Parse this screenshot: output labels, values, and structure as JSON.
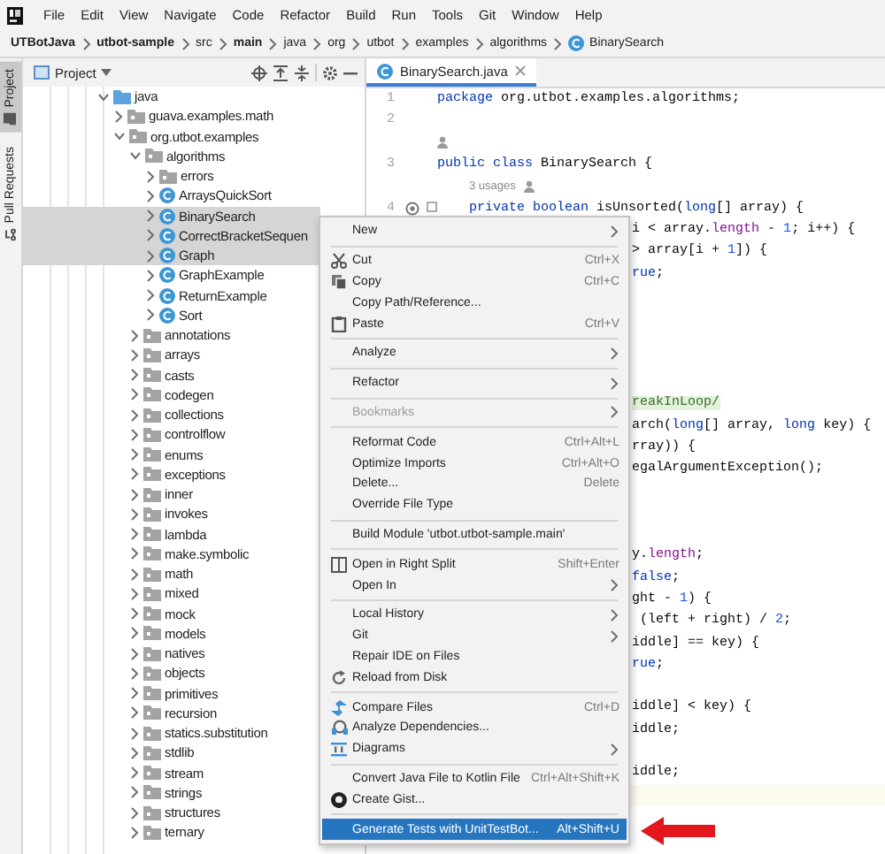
{
  "menubar": [
    "File",
    "Edit",
    "View",
    "Navigate",
    "Code",
    "Refactor",
    "Build",
    "Run",
    "Tools",
    "Git",
    "Window",
    "Help"
  ],
  "breadcrumbs": [
    {
      "label": "UTBotJava",
      "bold": true,
      "kind": "folder"
    },
    {
      "label": "utbot-sample",
      "bold": true,
      "kind": "folder"
    },
    {
      "label": "src",
      "bold": false,
      "kind": "folder"
    },
    {
      "label": "main",
      "bold": true,
      "kind": "folder"
    },
    {
      "label": "java",
      "bold": false,
      "kind": "folder"
    },
    {
      "label": "org",
      "bold": false,
      "kind": "folder"
    },
    {
      "label": "utbot",
      "bold": false,
      "kind": "folder"
    },
    {
      "label": "examples",
      "bold": false,
      "kind": "folder"
    },
    {
      "label": "algorithms",
      "bold": false,
      "kind": "folder"
    },
    {
      "label": "BinarySearch",
      "bold": false,
      "kind": "class"
    }
  ],
  "side_tabs": [
    {
      "label": "Project",
      "selected": true
    },
    {
      "label": "Pull Requests",
      "selected": false
    }
  ],
  "project": {
    "title": "Project"
  },
  "tree": [
    {
      "label": "java",
      "kind": "source-root",
      "expanded": true,
      "selected": false,
      "children": [
        {
          "label": "guava.examples.math",
          "kind": "package",
          "expanded": false,
          "selected": false
        },
        {
          "label": "org.utbot.examples",
          "kind": "package",
          "expanded": true,
          "selected": false,
          "children": [
            {
              "label": "algorithms",
              "kind": "package",
              "expanded": true,
              "selected": false,
              "children": [
                {
                  "label": "errors",
                  "kind": "package",
                  "expanded": false,
                  "selected": false
                },
                {
                  "label": "ArraysQuickSort",
                  "kind": "class",
                  "expanded": false,
                  "selected": false
                },
                {
                  "label": "BinarySearch",
                  "kind": "class",
                  "expanded": false,
                  "selected": true
                },
                {
                  "label": "CorrectBracketSequen",
                  "kind": "class",
                  "expanded": false,
                  "selected": true
                },
                {
                  "label": "Graph",
                  "kind": "class",
                  "expanded": false,
                  "selected": true
                },
                {
                  "label": "GraphExample",
                  "kind": "class",
                  "expanded": false,
                  "selected": false
                },
                {
                  "label": "ReturnExample",
                  "kind": "class",
                  "expanded": false,
                  "selected": false
                },
                {
                  "label": "Sort",
                  "kind": "class",
                  "expanded": false,
                  "selected": false
                }
              ]
            },
            {
              "label": "annotations",
              "kind": "package",
              "expanded": false,
              "selected": false
            },
            {
              "label": "arrays",
              "kind": "package",
              "expanded": false,
              "selected": false
            },
            {
              "label": "casts",
              "kind": "package",
              "expanded": false,
              "selected": false
            },
            {
              "label": "codegen",
              "kind": "package",
              "expanded": false,
              "selected": false
            },
            {
              "label": "collections",
              "kind": "package",
              "expanded": false,
              "selected": false
            },
            {
              "label": "controlflow",
              "kind": "package",
              "expanded": false,
              "selected": false
            },
            {
              "label": "enums",
              "kind": "package",
              "expanded": false,
              "selected": false
            },
            {
              "label": "exceptions",
              "kind": "package",
              "expanded": false,
              "selected": false
            },
            {
              "label": "inner",
              "kind": "package",
              "expanded": false,
              "selected": false
            },
            {
              "label": "invokes",
              "kind": "package",
              "expanded": false,
              "selected": false
            },
            {
              "label": "lambda",
              "kind": "package",
              "expanded": false,
              "selected": false
            },
            {
              "label": "make.symbolic",
              "kind": "package",
              "expanded": false,
              "selected": false
            },
            {
              "label": "math",
              "kind": "package",
              "expanded": false,
              "selected": false
            },
            {
              "label": "mixed",
              "kind": "package",
              "expanded": false,
              "selected": false
            },
            {
              "label": "mock",
              "kind": "package",
              "expanded": false,
              "selected": false
            },
            {
              "label": "models",
              "kind": "package",
              "expanded": false,
              "selected": false
            },
            {
              "label": "natives",
              "kind": "package",
              "expanded": false,
              "selected": false
            },
            {
              "label": "objects",
              "kind": "package",
              "expanded": false,
              "selected": false
            },
            {
              "label": "primitives",
              "kind": "package",
              "expanded": false,
              "selected": false
            },
            {
              "label": "recursion",
              "kind": "package",
              "expanded": false,
              "selected": false
            },
            {
              "label": "statics.substitution",
              "kind": "package",
              "expanded": false,
              "selected": false
            },
            {
              "label": "stdlib",
              "kind": "package",
              "expanded": false,
              "selected": false
            },
            {
              "label": "stream",
              "kind": "package",
              "expanded": false,
              "selected": false
            },
            {
              "label": "strings",
              "kind": "package",
              "expanded": false,
              "selected": false
            },
            {
              "label": "structures",
              "kind": "package",
              "expanded": false,
              "selected": false
            },
            {
              "label": "ternary",
              "kind": "package",
              "expanded": false,
              "selected": false
            }
          ]
        }
      ]
    }
  ],
  "editor_tabs": [
    {
      "label": "BinarySearch.java",
      "selected": true
    }
  ],
  "editor_rows": [
    {
      "kind": "code",
      "number": "1",
      "tokens": [
        {
          "kind": "keyword",
          "text": "package"
        },
        {
          "kind": "plain",
          "text": " org.utbot.examples.algorithms;"
        }
      ]
    },
    {
      "kind": "code",
      "number": "2"
    },
    {
      "kind": "author"
    },
    {
      "kind": "code",
      "number": "3",
      "tokens": [
        {
          "kind": "keyword",
          "text": "public class"
        },
        {
          "kind": "plain",
          "text": " BinarySearch {"
        }
      ]
    },
    {
      "kind": "usages",
      "text": "3 usages"
    },
    {
      "kind": "method",
      "number": "4",
      "tokens": [
        {
          "kind": "keyword",
          "text": "    private boolean"
        },
        {
          "kind": "plain",
          "text": " isUnsorted("
        },
        {
          "kind": "keyword",
          "text": "long"
        },
        {
          "kind": "plain",
          "text": "[] array) {"
        }
      ]
    },
    {
      "kind": "covered",
      "tokens": [
        {
          "kind": "plain",
          "text": "i < array."
        },
        {
          "kind": "field",
          "text": "length"
        },
        {
          "kind": "plain",
          "text": " - "
        },
        {
          "kind": "number",
          "text": "1"
        },
        {
          "kind": "plain",
          "text": "; i++) {"
        }
      ]
    },
    {
      "kind": "covered",
      "tokens": [
        {
          "kind": "plain",
          "text": "> array[i + "
        },
        {
          "kind": "number",
          "text": "1"
        },
        {
          "kind": "plain",
          "text": "]) {"
        }
      ]
    },
    {
      "kind": "covered",
      "tokens": [
        {
          "kind": "keyword",
          "text": "rue"
        },
        {
          "kind": "plain",
          "text": ";"
        }
      ]
    },
    {
      "kind": "blank"
    },
    {
      "kind": "blank"
    },
    {
      "kind": "blank"
    },
    {
      "kind": "blank"
    },
    {
      "kind": "blank"
    },
    {
      "kind": "covered",
      "tokens": [
        {
          "kind": "inspection",
          "text": "reakInLoop/"
        }
      ]
    },
    {
      "kind": "covered",
      "tokens": [
        {
          "kind": "plain",
          "text": "arch("
        },
        {
          "kind": "keyword",
          "text": "long"
        },
        {
          "kind": "plain",
          "text": "[] array, "
        },
        {
          "kind": "keyword",
          "text": "long"
        },
        {
          "kind": "plain",
          "text": " key) {"
        }
      ]
    },
    {
      "kind": "covered",
      "tokens": [
        {
          "kind": "plain",
          "text": "rray)) {"
        }
      ]
    },
    {
      "kind": "covered",
      "tokens": [
        {
          "kind": "plain",
          "text": "egalArgumentException();"
        }
      ]
    },
    {
      "kind": "blank"
    },
    {
      "kind": "blank"
    },
    {
      "kind": "blank"
    },
    {
      "kind": "covered",
      "tokens": [
        {
          "kind": "plain",
          "text": "y."
        },
        {
          "kind": "field",
          "text": "length"
        },
        {
          "kind": "plain",
          "text": ";"
        }
      ]
    },
    {
      "kind": "covered",
      "tokens": [
        {
          "kind": "keyword",
          "text": "false"
        },
        {
          "kind": "plain",
          "text": ";"
        }
      ]
    },
    {
      "kind": "covered",
      "tokens": [
        {
          "kind": "plain",
          "text": "ght - "
        },
        {
          "kind": "number",
          "text": "1"
        },
        {
          "kind": "plain",
          "text": ") {"
        }
      ]
    },
    {
      "kind": "covered",
      "tokens": [
        {
          "kind": "plain",
          "text": " (left + right) / "
        },
        {
          "kind": "number",
          "text": "2"
        },
        {
          "kind": "plain",
          "text": ";"
        }
      ]
    },
    {
      "kind": "covered",
      "tokens": [
        {
          "kind": "plain",
          "text": "iddle] == key) {"
        }
      ]
    },
    {
      "kind": "covered",
      "tokens": [
        {
          "kind": "keyword",
          "text": "rue"
        },
        {
          "kind": "plain",
          "text": ";"
        }
      ]
    },
    {
      "kind": "blank"
    },
    {
      "kind": "covered",
      "tokens": [
        {
          "kind": "plain",
          "text": "iddle] < key) {"
        }
      ]
    },
    {
      "kind": "covered",
      "tokens": [
        {
          "kind": "plain",
          "text": "iddle;"
        }
      ]
    },
    {
      "kind": "blank"
    },
    {
      "kind": "covered",
      "tokens": [
        {
          "kind": "plain",
          "text": "iddle;"
        }
      ]
    },
    {
      "kind": "current"
    }
  ],
  "context_menu": [
    {
      "kind": "item",
      "label": "New",
      "submenu": true,
      "disabled": false,
      "selected": false
    },
    {
      "kind": "separator"
    },
    {
      "kind": "item",
      "label": "Cut",
      "shortcut": "Ctrl+X",
      "submenu": false,
      "disabled": false,
      "selected": false
    },
    {
      "kind": "item",
      "label": "Copy",
      "shortcut": "Ctrl+C",
      "submenu": false,
      "disabled": false,
      "selected": false
    },
    {
      "kind": "item",
      "label": "Copy Path/Reference...",
      "submenu": false,
      "disabled": false,
      "selected": false
    },
    {
      "kind": "item",
      "label": "Paste",
      "shortcut": "Ctrl+V",
      "submenu": false,
      "disabled": false,
      "selected": false
    },
    {
      "kind": "separator"
    },
    {
      "kind": "item",
      "label": "Analyze",
      "submenu": true,
      "disabled": false,
      "selected": false
    },
    {
      "kind": "separator"
    },
    {
      "kind": "item",
      "label": "Refactor",
      "submenu": true,
      "disabled": false,
      "selected": false
    },
    {
      "kind": "separator"
    },
    {
      "kind": "item",
      "label": "Bookmarks",
      "submenu": true,
      "disabled": true,
      "selected": false
    },
    {
      "kind": "separator"
    },
    {
      "kind": "item",
      "label": "Reformat Code",
      "shortcut": "Ctrl+Alt+L",
      "submenu": false,
      "disabled": false,
      "selected": false
    },
    {
      "kind": "item",
      "label": "Optimize Imports",
      "shortcut": "Ctrl+Alt+O",
      "submenu": false,
      "disabled": false,
      "selected": false
    },
    {
      "kind": "item",
      "label": "Delete...",
      "shortcut": "Delete",
      "submenu": false,
      "disabled": false,
      "selected": false
    },
    {
      "kind": "item",
      "label": "Override File Type",
      "submenu": false,
      "disabled": false,
      "selected": false
    },
    {
      "kind": "separator"
    },
    {
      "kind": "item",
      "label": "Build Module 'utbot.utbot-sample.main'",
      "submenu": false,
      "disabled": false,
      "selected": false
    },
    {
      "kind": "separator"
    },
    {
      "kind": "item",
      "label": "Open in Right Split",
      "shortcut": "Shift+Enter",
      "submenu": false,
      "disabled": false,
      "selected": false
    },
    {
      "kind": "item",
      "label": "Open In",
      "submenu": true,
      "disabled": false,
      "selected": false
    },
    {
      "kind": "separator"
    },
    {
      "kind": "item",
      "label": "Local History",
      "submenu": true,
      "disabled": false,
      "selected": false
    },
    {
      "kind": "item",
      "label": "Git",
      "submenu": true,
      "disabled": false,
      "selected": false
    },
    {
      "kind": "item",
      "label": "Repair IDE on Files",
      "submenu": false,
      "disabled": false,
      "selected": false
    },
    {
      "kind": "item",
      "label": "Reload from Disk",
      "submenu": false,
      "disabled": false,
      "selected": false
    },
    {
      "kind": "separator"
    },
    {
      "kind": "item",
      "label": "Compare Files",
      "shortcut": "Ctrl+D",
      "submenu": false,
      "disabled": false,
      "selected": false
    },
    {
      "kind": "item",
      "label": "Analyze Dependencies...",
      "submenu": false,
      "disabled": false,
      "selected": false
    },
    {
      "kind": "item",
      "label": "Diagrams",
      "submenu": true,
      "disabled": false,
      "selected": false
    },
    {
      "kind": "separator"
    },
    {
      "kind": "item",
      "label": "Convert Java File to Kotlin File",
      "shortcut": "Ctrl+Alt+Shift+K",
      "submenu": false,
      "disabled": false,
      "selected": false
    },
    {
      "kind": "item",
      "label": "Create Gist...",
      "submenu": false,
      "disabled": false,
      "selected": false
    },
    {
      "kind": "separator"
    },
    {
      "kind": "item",
      "label": "Generate Tests with UnitTestBot...",
      "shortcut": "Alt+Shift+U",
      "submenu": false,
      "disabled": false,
      "selected": true
    }
  ]
}
